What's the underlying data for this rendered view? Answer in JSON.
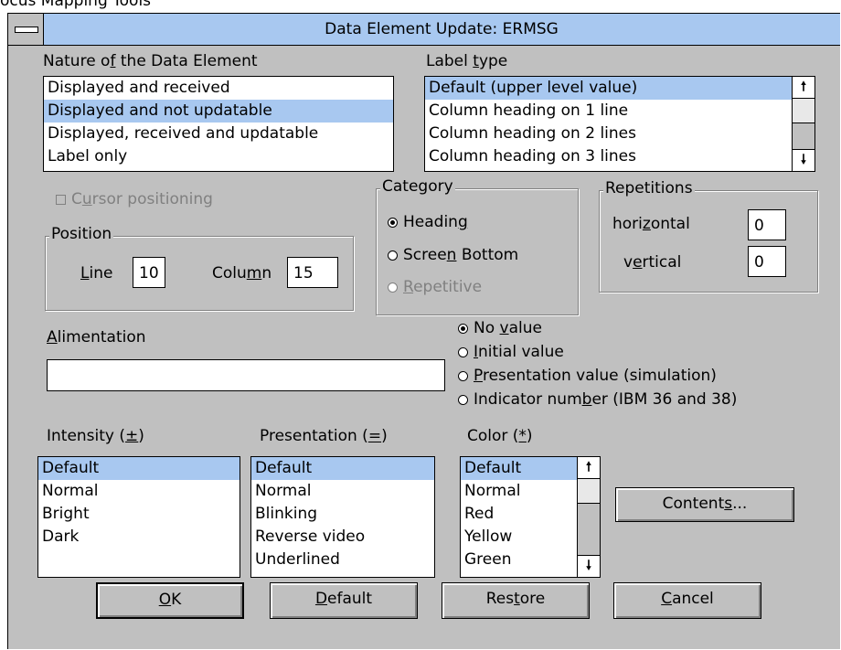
{
  "window": {
    "clipped_title": "ocus Mapping Tools",
    "title": "Data Element Update: ERMSG"
  },
  "nature": {
    "label_pre": "Nature o",
    "label_acc": "f",
    "label_post": " the Data Element",
    "items": [
      "Displayed and received",
      "Displayed and not updatable",
      "Displayed, received and updatable",
      "Label only"
    ],
    "selected_index": 1
  },
  "label_type": {
    "label_pre": "Label ",
    "label_acc": "t",
    "label_post": "ype",
    "items": [
      "Default (upper level value)",
      "Column heading on 1 line",
      "Column heading on 2 lines",
      "Column heading on 3 lines"
    ],
    "selected_index": 0
  },
  "cursor": {
    "pre": "C",
    "acc": "u",
    "post": "rsor positioning",
    "checked": false,
    "enabled": false
  },
  "position": {
    "group_label": "Position",
    "line_acc": "L",
    "line_post": "ine",
    "line_value": "10",
    "col_pre": "Colu",
    "col_acc": "m",
    "col_post": "n",
    "col_value": "15"
  },
  "category": {
    "group_label": "Category",
    "options": [
      {
        "pre": "Headin",
        "acc": "g",
        "post": "",
        "checked": true,
        "enabled": true
      },
      {
        "pre": "Scree",
        "acc": "n",
        "post": " Bottom",
        "checked": false,
        "enabled": true
      },
      {
        "pre": "",
        "acc": "R",
        "post": "epetitive",
        "checked": false,
        "enabled": false
      }
    ]
  },
  "repetitions": {
    "group_label": "Repetitions",
    "h_pre": "hori",
    "h_acc": "z",
    "h_post": "ontal",
    "h_value": "0",
    "v_pre": "v",
    "v_acc": "e",
    "v_post": "rtical",
    "v_value": "0"
  },
  "alimentation": {
    "label_acc": "A",
    "label_post": "limentation",
    "value": "",
    "options": [
      {
        "pre": "No ",
        "acc": "v",
        "post": "alue",
        "checked": true
      },
      {
        "pre": "",
        "acc": "I",
        "post": "nitial value",
        "checked": false
      },
      {
        "pre": "",
        "acc": "P",
        "post": "resentation value (simulation)",
        "checked": false
      },
      {
        "pre": "Indicator num",
        "acc": "b",
        "post": "er (IBM 36 and 38)",
        "checked": false
      }
    ]
  },
  "intensity": {
    "label_pre": "Intensity (",
    "label_acc": "±",
    "label_post": ")",
    "items": [
      "Default",
      "Normal",
      "Bright",
      "Dark"
    ],
    "selected_index": 0
  },
  "presentation": {
    "label_pre": "Presentation (",
    "label_acc": "=",
    "label_post": ")",
    "items": [
      "Default",
      "Normal",
      "Blinking",
      "Reverse video",
      "Underlined"
    ],
    "selected_index": 0
  },
  "color": {
    "label_pre": "Color (",
    "label_acc": "*",
    "label_post": ")",
    "items": [
      "Default",
      "Normal",
      "Red",
      "Yellow",
      "Green"
    ],
    "selected_index": 0
  },
  "buttons": {
    "contents": {
      "pre": "Content",
      "acc": "s",
      "post": "..."
    },
    "ok": {
      "pre": "",
      "acc": "O",
      "post": "K"
    },
    "default": {
      "pre": "",
      "acc": "D",
      "post": "efault"
    },
    "restore": {
      "pre": "Res",
      "acc": "t",
      "post": "ore"
    },
    "cancel": {
      "pre": "",
      "acc": "C",
      "post": "ancel"
    }
  },
  "colors": {
    "selection": "#a8c8f0",
    "dialog_bg": "#c0c0c0",
    "titlebar": "#a8c8f0"
  }
}
